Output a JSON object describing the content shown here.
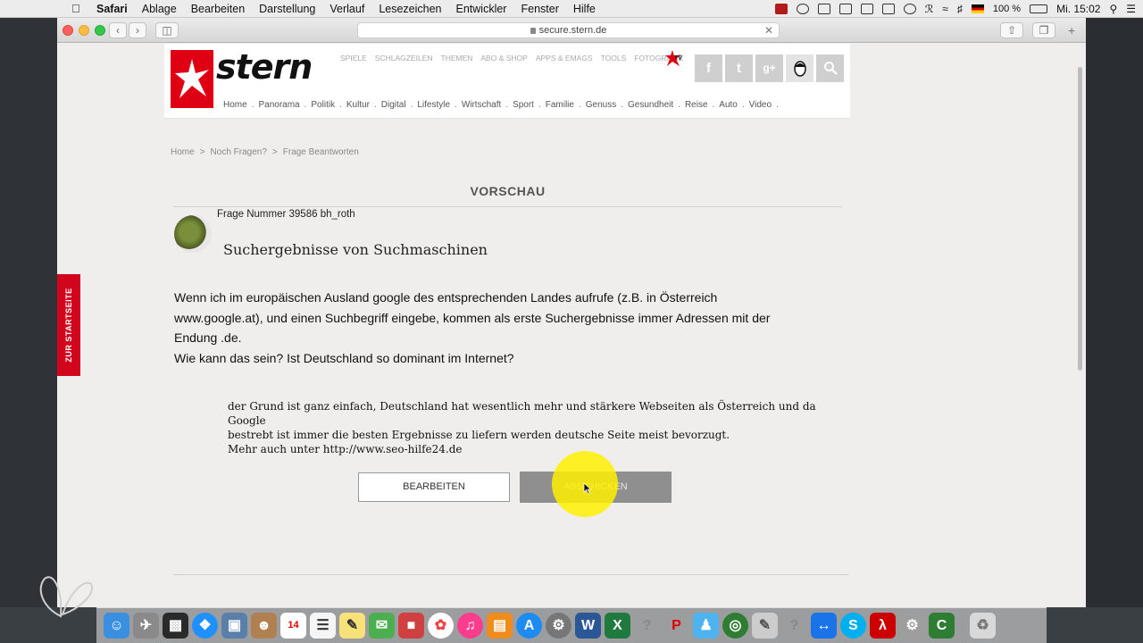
{
  "menubar": {
    "app_name": "Safari",
    "items": [
      "Ablage",
      "Bearbeiten",
      "Darstellung",
      "Verlauf",
      "Lesezeichen",
      "Entwickler",
      "Fenster",
      "Hilfe"
    ],
    "battery": "100 %",
    "clock": "Mi. 15:02"
  },
  "browser": {
    "url": "secure.stern.de"
  },
  "site": {
    "logo": "stern",
    "top_nav": [
      "SPIELE",
      "SCHLAGZEILEN",
      "THEMEN",
      "ABO & SHOP",
      "APPS & EMAGS",
      "TOOLS",
      "FOTOGRAFIE"
    ],
    "social": [
      {
        "icon": "facebook-icon",
        "glyph": "f"
      },
      {
        "icon": "twitter-icon",
        "glyph": "t"
      },
      {
        "icon": "google-plus-icon",
        "glyph": "g+"
      },
      {
        "icon": "user-icon",
        "glyph": ""
      },
      {
        "icon": "search-icon",
        "glyph": ""
      }
    ],
    "main_nav": [
      "Home",
      "Panorama",
      "Politik",
      "Kultur",
      "Digital",
      "Lifestyle",
      "Wirtschaft",
      "Sport",
      "Familie",
      "Genuss",
      "Gesundheit",
      "Reise",
      "Auto",
      "Video"
    ],
    "side_tab": "ZUR STARTSEITE"
  },
  "breadcrumb": [
    "Home",
    "Noch Fragen?",
    "Frage Beantworten"
  ],
  "breadcrumb_sep": ">",
  "preview": {
    "heading": "VORSCHAU",
    "question_number": "Frage Nummer 39586 bh_roth",
    "question_title": "Suchergebnisse von Suchmaschinen",
    "question_body": [
      "Wenn ich im europäischen Ausland google des entsprechenden Landes aufrufe (z.B. in Österreich",
      "www.google.at), und einen Suchbegriff eingebe, kommen als erste Suchergebnisse immer Adressen mit der",
      "Endung .de.",
      "Wie kann das sein? Ist Deutschland so dominant im Internet?"
    ],
    "answer": [
      "der Grund ist ganz einfach, Deutschland hat wesentlich mehr und stärkere Webseiten als Österreich und da Google",
      "bestrebt ist immer die besten Ergebnisse zu liefern werden deutsche Seite meist bevorzugt.",
      "Mehr auch unter http://www.seo-hilfe24.de"
    ],
    "edit_button": "BEARBEITEN",
    "send_button": "ABSCHICKEN"
  }
}
